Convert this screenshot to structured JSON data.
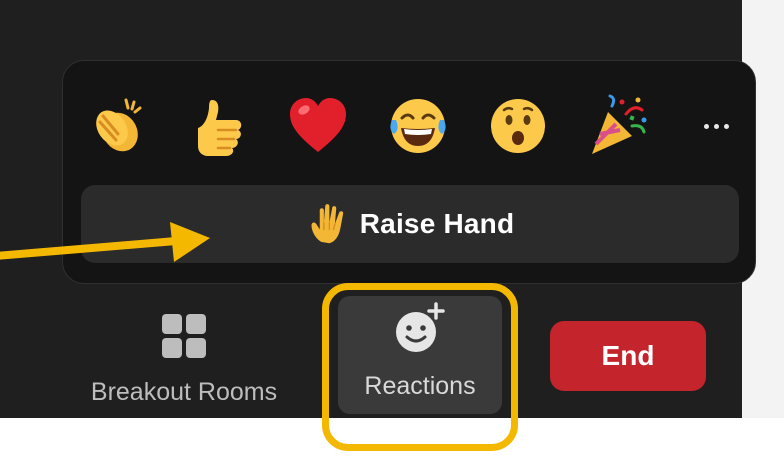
{
  "reactions_popover": {
    "emojis": [
      {
        "name": "clapping-hands-emoji"
      },
      {
        "name": "thumbs-up-emoji"
      },
      {
        "name": "red-heart-emoji"
      },
      {
        "name": "tears-of-joy-emoji"
      },
      {
        "name": "open-mouth-emoji"
      },
      {
        "name": "party-popper-emoji"
      }
    ],
    "more_icon": "ellipsis-icon",
    "raise_hand": {
      "label": "Raise Hand",
      "icon": "raised-hand-icon"
    }
  },
  "toolbar": {
    "breakout_rooms": {
      "label": "Breakout Rooms",
      "icon": "grid-icon"
    },
    "reactions": {
      "label": "Reactions",
      "icon": "smiley-plus-icon"
    },
    "end": {
      "label": "End"
    }
  },
  "colors": {
    "annotation": "#f5b800",
    "end_button": "#c4242c",
    "popover_bg": "#141414",
    "toolbar_bg": "#1f1f1f"
  }
}
